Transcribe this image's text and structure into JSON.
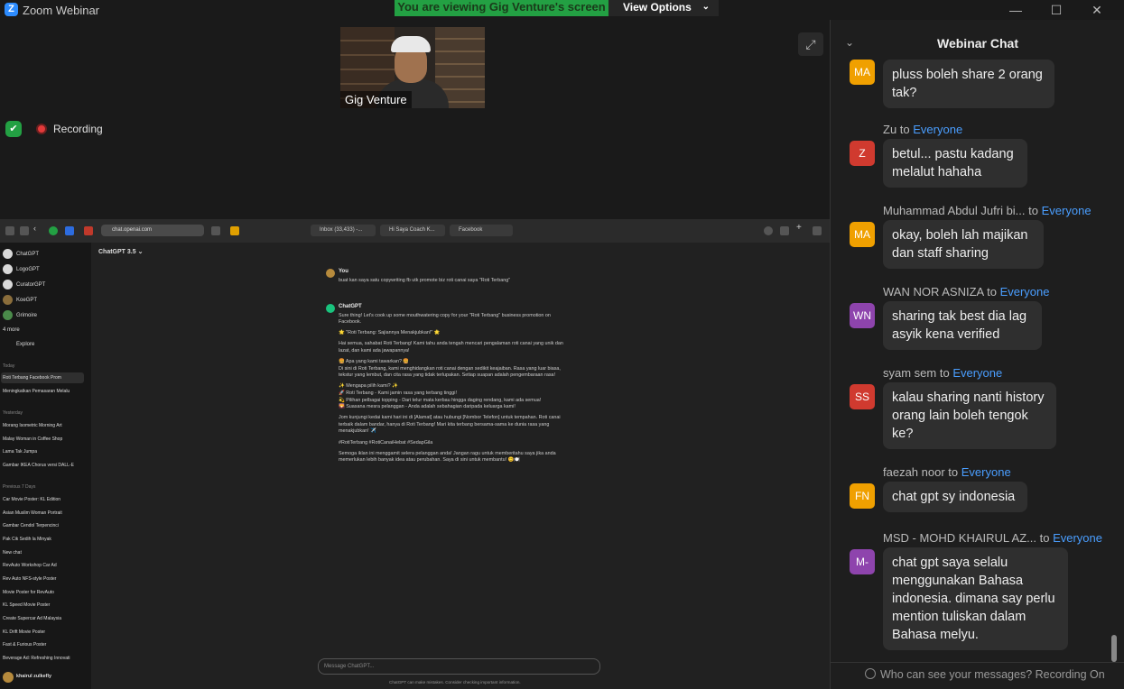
{
  "window": {
    "title": "Zoom Webinar",
    "share_banner": "You are viewing Gig Venture's screen",
    "view_options": "View Options"
  },
  "video": {
    "participant_name": "Gig Venture"
  },
  "recording": {
    "label": "Recording"
  },
  "browser": {
    "url": "chat.openai.com",
    "tabs": [
      "Inbox (33,433) -...",
      "Hi Saya Coach K...",
      "Facebook"
    ]
  },
  "gpt": {
    "model": "ChatGPT 3.5",
    "gpts": [
      "ChatGPT",
      "LogoGPT",
      "CuratorGPT",
      "KoeGPT",
      "Grimoire"
    ],
    "more": "4 more",
    "explore": "Explore",
    "sections": {
      "today": "Today",
      "yesterday": "Yesterday",
      "prev7": "Previous 7 Days"
    },
    "today_items": [
      "Roti Terbang Facebook Prom",
      "Meningkatkan Pemasaran Melalu"
    ],
    "yesterday_items": [
      "Morang Isometric Morning Art",
      "Malay Woman in Coffee Shop",
      "Lama Tak Jumpa",
      "Gambar IKEA Chorus versi DALL-E"
    ],
    "prev7_items": [
      "Car Movie Poster: KL Edition",
      "Asian Muslim Woman Portrait",
      "Gambar Cendol Terpencinci",
      "Pak Cik Sedih la Minyak",
      "New chat",
      "RevAuto Workshop Car Ad",
      "Rev Auto NFS-style Poster",
      "Movie Poster for RevAuto",
      "KL Speed Movie Poster",
      "Create Supercar Ad Malaysia",
      "KL Drift Movie Poster",
      "Fast & Furious Poster",
      "Beverage Ad: Refreshing Innovati"
    ],
    "user": "khairul zulkefly",
    "you_label": "You",
    "you_msg": "buat kan saya satu copywriting fb utk promote biz roti canai saya \"Roti Terbang\"",
    "bot_label": "ChatGPT",
    "bot_paragraphs": [
      "Sure thing! Let's cook up some mouthwatering copy for your \"Roti Terbang\" business promotion on Facebook.",
      "🌟 \"Roti Terbang: Sajiannya Menakjubkan!\" 🌟",
      "Hai semua, sahabat Roti Terbang! Kami tahu anda tengah mencari pengalaman roti canai yang unik dan lazat, dan kami ada jawapannya!",
      "🍔 Apa yang kami tawarkan? 🍔\nDi sini di Roti Terbang, kami menghidangkan roti canai dengan sedikit keajaiban. Rasa yang luar biasa, tekstur yang lembut, dan cita rasa yang tidak terlupakan. Setiap suapan adalah pengembaraan rasa!",
      "✨ Mengapa pilih kami? ✨\n🚀 Roti Terbang - Kami jamin rasa yang terbang tinggi!\n💫 Pilihan pelbagai topping - Dari telur mata kerbau hingga daging rendang, kami ada semua!\n🌄 Suasana mesra pelanggan - Anda adalah sebahagian daripada keluarga kami!",
      "Jom kunjungi kedai kami hari ini di [Alamat] atau hubungi [Nombor Telefon] untuk tempahan. Roti canai terbaik dalam bandar, hanya di Roti Terbang! Mari kita terbang bersama-sama ke dunia rasa yang menakjubkan! ✈️",
      "#RotiTerbang #RotiCanaiHebat #SedapGila",
      "Semoga iklan ini menggamit selera pelanggan anda! Jangan ragu untuk memberitahu saya jika anda memerlukan lebih banyak idea atau perubahan. Saya di sini untuk membantu! 😊🍽️"
    ],
    "composer_placeholder": "Message ChatGPT...",
    "disclaimer": "ChatGPT can make mistakes. Consider checking important information."
  },
  "chat": {
    "title": "Webinar Chat",
    "to_word": "to",
    "everyone": "Everyone",
    "messages": [
      {
        "initials": "MA",
        "color": "#f0a000",
        "sender": "",
        "text": "pluss boleh share 2 orang tak?"
      },
      {
        "initials": "Z",
        "color": "#d03a2f",
        "sender": "Zu",
        "text": "betul... pastu kadang melalut hahaha"
      },
      {
        "initials": "MA",
        "color": "#f0a000",
        "sender": "Muhammad Abdul Jufri bi...",
        "text": "okay, boleh lah majikan dan staff sharing"
      },
      {
        "initials": "WN",
        "color": "#8e44ad",
        "sender": "WAN NOR ASNIZA",
        "text": "sharing tak best dia lag asyik kena verified"
      },
      {
        "initials": "SS",
        "color": "#d03a2f",
        "sender": "syam sem",
        "text": "kalau sharing nanti history orang lain boleh tengok ke?"
      },
      {
        "initials": "FN",
        "color": "#f0a000",
        "sender": "faezah noor",
        "text": "chat gpt sy indonesia"
      },
      {
        "initials": "M-",
        "color": "#8e44ad",
        "sender": "MSD - MOHD KHAIRUL AZ...",
        "text": "chat gpt saya selalu menggunakan Bahasa indonesia. dimana say perlu mention tuliskan dalam Bahasa melyu."
      }
    ],
    "footer": "Who can see your messages? Recording On"
  }
}
